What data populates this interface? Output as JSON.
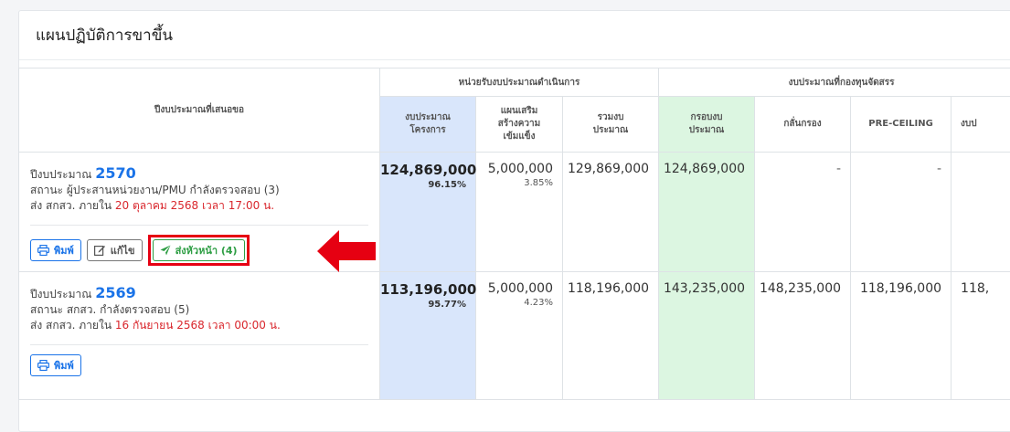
{
  "page": {
    "title": "แผนปฏิบัติการขาขึ้น"
  },
  "table": {
    "col_fiscal_year": "ปีงบประมาณที่เสนอขอ",
    "group_operating": "หน่วยรับงบประมาณดำเนินการ",
    "group_fund": "งบประมาณที่กองทุนจัดสรร",
    "sub_headers": {
      "project_budget": "งบประมาณ\nโครงการ",
      "supplement_plan": "แผนเสริม\nสร้างความ\nเข้มแข็ง",
      "total_budget": "รวมงบ\nประมาณ",
      "budget_frame": "กรอบงบ\nประมาณ",
      "screening": "กลั่นกรอง",
      "pre_ceiling": "PRE-CEILING",
      "cut": "งบป"
    }
  },
  "rows": [
    {
      "fy_label": "ปีงบประมาณ",
      "fy_year": "2570",
      "status_label": "สถานะ",
      "status_value": "ผู้ประสานหน่วยงาน/PMU กำลังตรวจสอบ (3)",
      "deadline_prefix": "ส่ง สกสว. ภายใน",
      "deadline_date": "20 ตุลาคม",
      "deadline_suffix": "2568 เวลา 17:00 น.",
      "project_budget": "124,869,000",
      "project_pct": "96.15%",
      "supplement": "5,000,000",
      "supplement_pct": "3.85%",
      "total": "129,869,000",
      "frame": "124,869,000",
      "screening": "-",
      "pre_ceiling": "-",
      "cut": "",
      "buttons": {
        "print": "พิมพ์",
        "edit": "แก้ไข",
        "send": "ส่งหัวหน้า (4)"
      }
    },
    {
      "fy_label": "ปีงบประมาณ",
      "fy_year": "2569",
      "status_label": "สถานะ",
      "status_value": "สกสว. กำลังตรวจสอบ (5)",
      "deadline_prefix": "ส่ง สกสว. ภายใน",
      "deadline_date": "16 กันยายน",
      "deadline_suffix": "2568 เวลา 00:00 น.",
      "project_budget": "113,196,000",
      "project_pct": "95.77%",
      "supplement": "5,000,000",
      "supplement_pct": "4.23%",
      "total": "118,196,000",
      "frame": "143,235,000",
      "screening": "148,235,000",
      "pre_ceiling": "118,196,000",
      "cut": "118,",
      "buttons": {
        "print": "พิมพ์"
      }
    }
  ],
  "colors": {
    "accent_blue": "#1a73e8",
    "success_green": "#2e9e44",
    "highlight_red": "#e60012",
    "budget_blue_bg": "#d9e6fb",
    "frame_green_bg": "#dcf6e1"
  },
  "icons": {
    "print": "printer-icon",
    "edit": "edit-icon",
    "send": "paper-plane-icon",
    "annotation": "red-arrow-icon"
  }
}
